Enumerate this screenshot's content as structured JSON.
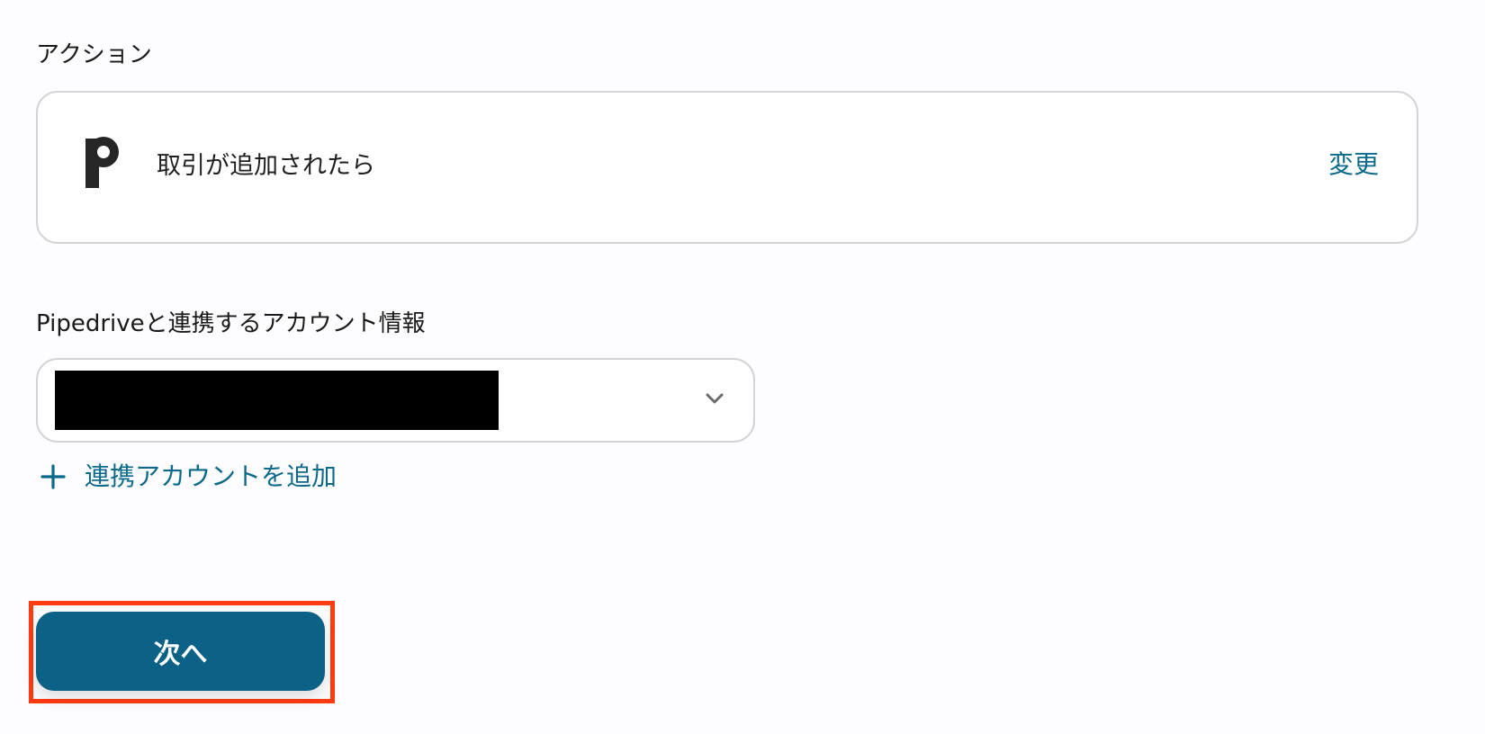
{
  "action_section": {
    "label": "アクション",
    "app_icon": "pipedrive-p-icon",
    "action_title": "取引が追加されたら",
    "change_label": "変更"
  },
  "account_section": {
    "label": "Pipedriveと連携するアカウント情報",
    "selected_account": "",
    "dropdown_icon": "chevron-down-icon",
    "add_icon": "plus-icon",
    "add_account_label": "連携アカウントを追加"
  },
  "footer": {
    "next_label": "次へ"
  },
  "colors": {
    "link": "#0b6a8a",
    "primary_button": "#0c6286",
    "highlight": "#ff3b12",
    "border": "#d4d4d6"
  }
}
